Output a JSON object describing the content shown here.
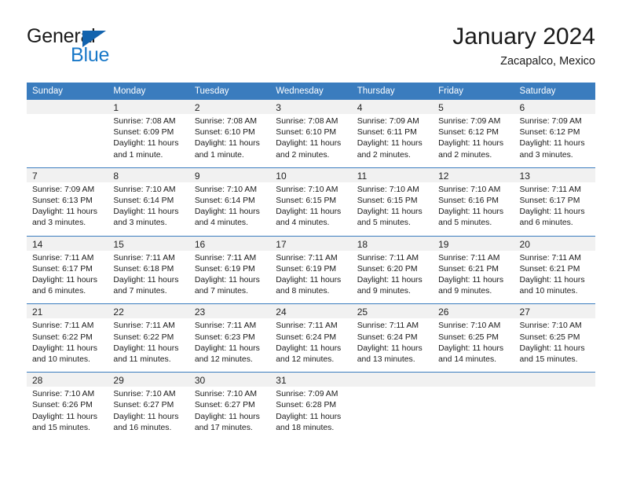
{
  "brand": {
    "name_part1": "General",
    "name_part2": "Blue",
    "triangle_icon": "triangle-icon",
    "accent_color": "#1878c8",
    "triangle_color": "#1263ae"
  },
  "header": {
    "title": "January 2024",
    "subtitle": "Zacapalco, Mexico"
  },
  "calendar": {
    "header_bg": "#3a7cbe",
    "daynum_bg": "#f1f1f1",
    "weekdays": [
      "Sunday",
      "Monday",
      "Tuesday",
      "Wednesday",
      "Thursday",
      "Friday",
      "Saturday"
    ],
    "weeks": [
      [
        {
          "day": "",
          "sunrise": "",
          "sunset": "",
          "daylight_line1": "",
          "daylight_line2": "",
          "empty": true
        },
        {
          "day": "1",
          "sunrise": "Sunrise: 7:08 AM",
          "sunset": "Sunset: 6:09 PM",
          "daylight_line1": "Daylight: 11 hours",
          "daylight_line2": "and 1 minute."
        },
        {
          "day": "2",
          "sunrise": "Sunrise: 7:08 AM",
          "sunset": "Sunset: 6:10 PM",
          "daylight_line1": "Daylight: 11 hours",
          "daylight_line2": "and 1 minute."
        },
        {
          "day": "3",
          "sunrise": "Sunrise: 7:08 AM",
          "sunset": "Sunset: 6:10 PM",
          "daylight_line1": "Daylight: 11 hours",
          "daylight_line2": "and 2 minutes."
        },
        {
          "day": "4",
          "sunrise": "Sunrise: 7:09 AM",
          "sunset": "Sunset: 6:11 PM",
          "daylight_line1": "Daylight: 11 hours",
          "daylight_line2": "and 2 minutes."
        },
        {
          "day": "5",
          "sunrise": "Sunrise: 7:09 AM",
          "sunset": "Sunset: 6:12 PM",
          "daylight_line1": "Daylight: 11 hours",
          "daylight_line2": "and 2 minutes."
        },
        {
          "day": "6",
          "sunrise": "Sunrise: 7:09 AM",
          "sunset": "Sunset: 6:12 PM",
          "daylight_line1": "Daylight: 11 hours",
          "daylight_line2": "and 3 minutes."
        }
      ],
      [
        {
          "day": "7",
          "sunrise": "Sunrise: 7:09 AM",
          "sunset": "Sunset: 6:13 PM",
          "daylight_line1": "Daylight: 11 hours",
          "daylight_line2": "and 3 minutes."
        },
        {
          "day": "8",
          "sunrise": "Sunrise: 7:10 AM",
          "sunset": "Sunset: 6:14 PM",
          "daylight_line1": "Daylight: 11 hours",
          "daylight_line2": "and 3 minutes."
        },
        {
          "day": "9",
          "sunrise": "Sunrise: 7:10 AM",
          "sunset": "Sunset: 6:14 PM",
          "daylight_line1": "Daylight: 11 hours",
          "daylight_line2": "and 4 minutes."
        },
        {
          "day": "10",
          "sunrise": "Sunrise: 7:10 AM",
          "sunset": "Sunset: 6:15 PM",
          "daylight_line1": "Daylight: 11 hours",
          "daylight_line2": "and 4 minutes."
        },
        {
          "day": "11",
          "sunrise": "Sunrise: 7:10 AM",
          "sunset": "Sunset: 6:15 PM",
          "daylight_line1": "Daylight: 11 hours",
          "daylight_line2": "and 5 minutes."
        },
        {
          "day": "12",
          "sunrise": "Sunrise: 7:10 AM",
          "sunset": "Sunset: 6:16 PM",
          "daylight_line1": "Daylight: 11 hours",
          "daylight_line2": "and 5 minutes."
        },
        {
          "day": "13",
          "sunrise": "Sunrise: 7:11 AM",
          "sunset": "Sunset: 6:17 PM",
          "daylight_line1": "Daylight: 11 hours",
          "daylight_line2": "and 6 minutes."
        }
      ],
      [
        {
          "day": "14",
          "sunrise": "Sunrise: 7:11 AM",
          "sunset": "Sunset: 6:17 PM",
          "daylight_line1": "Daylight: 11 hours",
          "daylight_line2": "and 6 minutes."
        },
        {
          "day": "15",
          "sunrise": "Sunrise: 7:11 AM",
          "sunset": "Sunset: 6:18 PM",
          "daylight_line1": "Daylight: 11 hours",
          "daylight_line2": "and 7 minutes."
        },
        {
          "day": "16",
          "sunrise": "Sunrise: 7:11 AM",
          "sunset": "Sunset: 6:19 PM",
          "daylight_line1": "Daylight: 11 hours",
          "daylight_line2": "and 7 minutes."
        },
        {
          "day": "17",
          "sunrise": "Sunrise: 7:11 AM",
          "sunset": "Sunset: 6:19 PM",
          "daylight_line1": "Daylight: 11 hours",
          "daylight_line2": "and 8 minutes."
        },
        {
          "day": "18",
          "sunrise": "Sunrise: 7:11 AM",
          "sunset": "Sunset: 6:20 PM",
          "daylight_line1": "Daylight: 11 hours",
          "daylight_line2": "and 9 minutes."
        },
        {
          "day": "19",
          "sunrise": "Sunrise: 7:11 AM",
          "sunset": "Sunset: 6:21 PM",
          "daylight_line1": "Daylight: 11 hours",
          "daylight_line2": "and 9 minutes."
        },
        {
          "day": "20",
          "sunrise": "Sunrise: 7:11 AM",
          "sunset": "Sunset: 6:21 PM",
          "daylight_line1": "Daylight: 11 hours",
          "daylight_line2": "and 10 minutes."
        }
      ],
      [
        {
          "day": "21",
          "sunrise": "Sunrise: 7:11 AM",
          "sunset": "Sunset: 6:22 PM",
          "daylight_line1": "Daylight: 11 hours",
          "daylight_line2": "and 10 minutes."
        },
        {
          "day": "22",
          "sunrise": "Sunrise: 7:11 AM",
          "sunset": "Sunset: 6:22 PM",
          "daylight_line1": "Daylight: 11 hours",
          "daylight_line2": "and 11 minutes."
        },
        {
          "day": "23",
          "sunrise": "Sunrise: 7:11 AM",
          "sunset": "Sunset: 6:23 PM",
          "daylight_line1": "Daylight: 11 hours",
          "daylight_line2": "and 12 minutes."
        },
        {
          "day": "24",
          "sunrise": "Sunrise: 7:11 AM",
          "sunset": "Sunset: 6:24 PM",
          "daylight_line1": "Daylight: 11 hours",
          "daylight_line2": "and 12 minutes."
        },
        {
          "day": "25",
          "sunrise": "Sunrise: 7:11 AM",
          "sunset": "Sunset: 6:24 PM",
          "daylight_line1": "Daylight: 11 hours",
          "daylight_line2": "and 13 minutes."
        },
        {
          "day": "26",
          "sunrise": "Sunrise: 7:10 AM",
          "sunset": "Sunset: 6:25 PM",
          "daylight_line1": "Daylight: 11 hours",
          "daylight_line2": "and 14 minutes."
        },
        {
          "day": "27",
          "sunrise": "Sunrise: 7:10 AM",
          "sunset": "Sunset: 6:25 PM",
          "daylight_line1": "Daylight: 11 hours",
          "daylight_line2": "and 15 minutes."
        }
      ],
      [
        {
          "day": "28",
          "sunrise": "Sunrise: 7:10 AM",
          "sunset": "Sunset: 6:26 PM",
          "daylight_line1": "Daylight: 11 hours",
          "daylight_line2": "and 15 minutes."
        },
        {
          "day": "29",
          "sunrise": "Sunrise: 7:10 AM",
          "sunset": "Sunset: 6:27 PM",
          "daylight_line1": "Daylight: 11 hours",
          "daylight_line2": "and 16 minutes."
        },
        {
          "day": "30",
          "sunrise": "Sunrise: 7:10 AM",
          "sunset": "Sunset: 6:27 PM",
          "daylight_line1": "Daylight: 11 hours",
          "daylight_line2": "and 17 minutes."
        },
        {
          "day": "31",
          "sunrise": "Sunrise: 7:09 AM",
          "sunset": "Sunset: 6:28 PM",
          "daylight_line1": "Daylight: 11 hours",
          "daylight_line2": "and 18 minutes."
        },
        {
          "day": "",
          "sunrise": "",
          "sunset": "",
          "daylight_line1": "",
          "daylight_line2": "",
          "empty": true
        },
        {
          "day": "",
          "sunrise": "",
          "sunset": "",
          "daylight_line1": "",
          "daylight_line2": "",
          "empty": true
        },
        {
          "day": "",
          "sunrise": "",
          "sunset": "",
          "daylight_line1": "",
          "daylight_line2": "",
          "empty": true
        }
      ]
    ]
  }
}
